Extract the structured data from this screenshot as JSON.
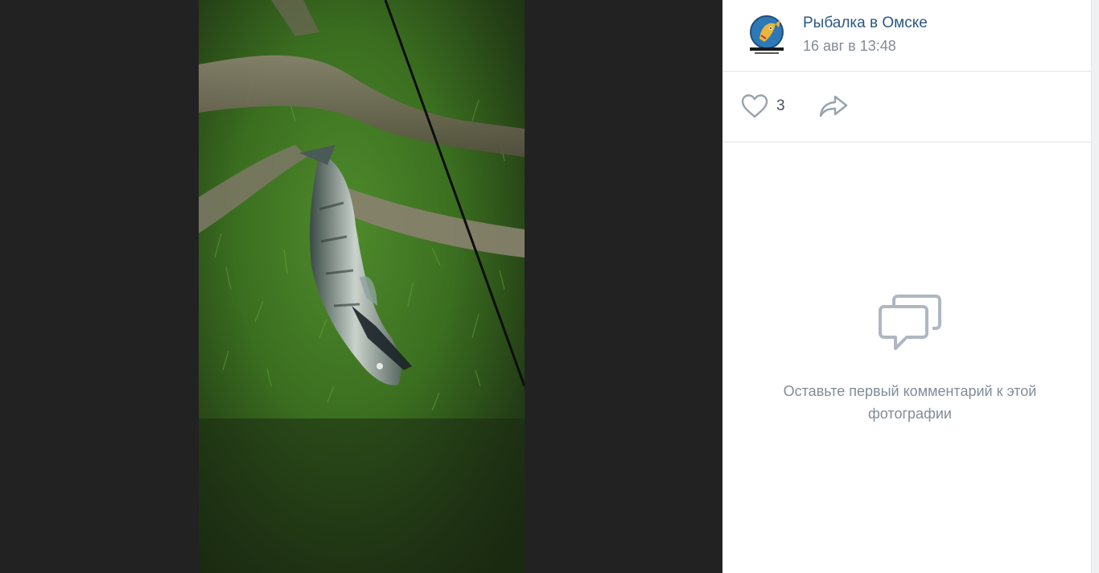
{
  "post": {
    "author": "Рыбалка в Омске",
    "date": "16 авг в 13:48",
    "avatar_icon": "fish-logo-avatar"
  },
  "actions": {
    "like_icon": "heart-icon",
    "like_count": "3",
    "share_icon": "share-arrow-icon"
  },
  "comments": {
    "empty_icon": "comment-bubbles-icon",
    "empty_text": "Оставьте первый комментарий к этой фотографии"
  },
  "colors": {
    "author_link": "#2a5885",
    "secondary_text": "#818c99",
    "viewer_bg": "#222222",
    "icon": "#99a2ad"
  }
}
